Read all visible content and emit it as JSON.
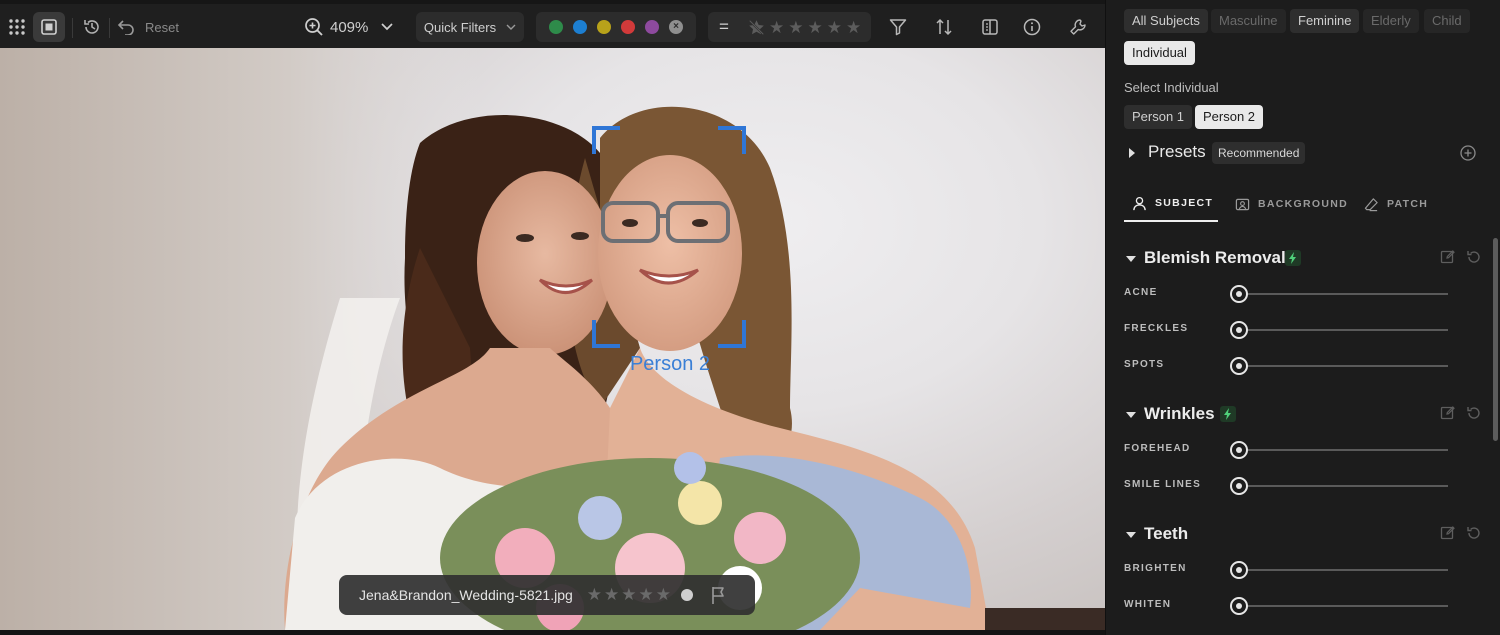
{
  "toolbar": {
    "reset_label": "Reset",
    "zoom_value": "409%",
    "quick_filters_label": "Quick Filters",
    "color_labels": [
      "#2e8b4a",
      "#1d7fd1",
      "#b8a21a",
      "#d23a3a",
      "#8e4a9e"
    ],
    "equals_symbol": "=",
    "rating_stars": 5
  },
  "canvas": {
    "face_label": "Person 2",
    "file_name": "Jena&Brandon_Wedding-5821.jpg"
  },
  "panel": {
    "subject_chips": [
      {
        "label": "All Subjects",
        "state": "normal"
      },
      {
        "label": "Masculine",
        "state": "disabled"
      },
      {
        "label": "Feminine",
        "state": "normal"
      },
      {
        "label": "Elderly",
        "state": "disabled"
      },
      {
        "label": "Child",
        "state": "disabled"
      },
      {
        "label": "Individual",
        "state": "active"
      }
    ],
    "select_individual_label": "Select Individual",
    "individuals": [
      {
        "label": "Person 1",
        "state": "normal"
      },
      {
        "label": "Person 2",
        "state": "active"
      }
    ],
    "presets_label": "Presets",
    "presets_tag": "Recommended",
    "tabs": [
      {
        "label": "SUBJECT",
        "icon": "person-icon",
        "active": true
      },
      {
        "label": "BACKGROUND",
        "icon": "image-icon",
        "active": false
      },
      {
        "label": "PATCH",
        "icon": "eraser-icon",
        "active": false
      }
    ],
    "sections": [
      {
        "title": "Blemish Removal",
        "sliders": [
          {
            "label": "ACNE",
            "value": 0
          },
          {
            "label": "FRECKLES",
            "value": 0
          },
          {
            "label": "SPOTS",
            "value": 0
          }
        ]
      },
      {
        "title": "Wrinkles",
        "sliders": [
          {
            "label": "FOREHEAD",
            "value": 0
          },
          {
            "label": "SMILE LINES",
            "value": 0
          }
        ]
      },
      {
        "title": "Teeth",
        "sliders": [
          {
            "label": "BRIGHTEN",
            "value": 0
          },
          {
            "label": "WHITEN",
            "value": 0
          }
        ]
      }
    ]
  }
}
